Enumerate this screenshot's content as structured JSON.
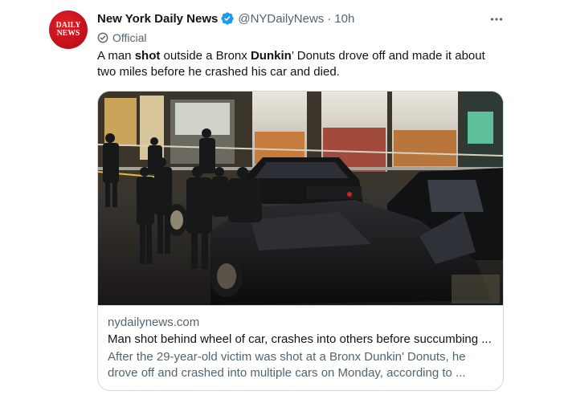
{
  "account": {
    "avatar_line1": "DAILY",
    "avatar_line2": "NEWS",
    "display_name": "New York Daily News",
    "handle": "@NYDailyNews",
    "separator": "·",
    "time": "10h",
    "label": "Official",
    "verified_icon": "verified-badge-icon",
    "verified_color": "#1d9bf0"
  },
  "tweet": {
    "text_1": "A man ",
    "text_2": "shot",
    "text_3": " outside a Bronx ",
    "text_4": "Dunkin",
    "text_5": "’ Donuts drove off and made it about two miles before he crashed his car and died."
  },
  "card": {
    "image_icon": "crash-scene-photo",
    "domain": "nydailynews.com",
    "title": "Man shot behind wheel of car, crashes into others before succumbing ...",
    "description": "After the 29-year-old victim was shot at a Bronx Dunkin' Donuts, he drove off and crashed into multiple cars on Monday, according to ..."
  },
  "colors": {
    "brand_red": "#c5121b",
    "secondary_text": "#536471",
    "border": "#cfd9de"
  }
}
